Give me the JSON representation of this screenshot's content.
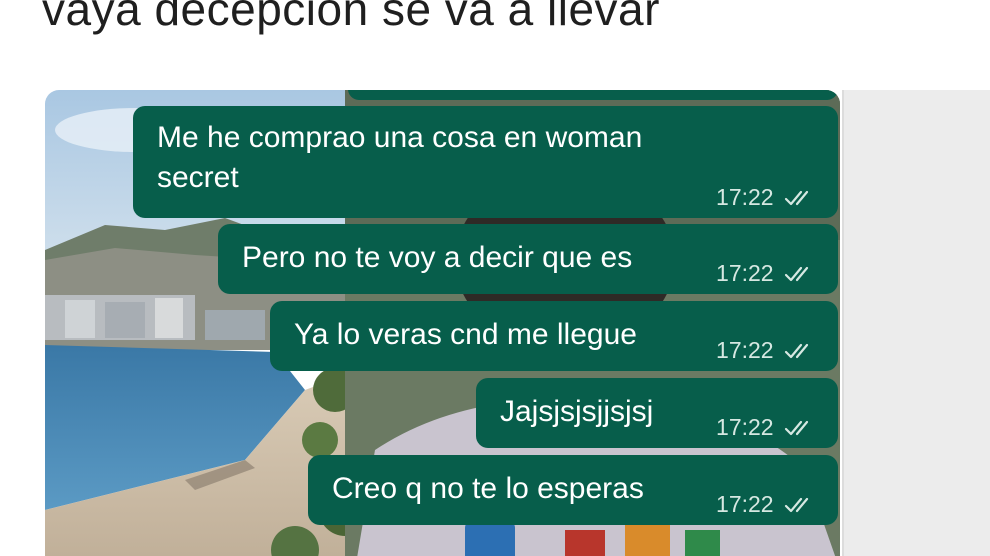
{
  "caption": "vaya decepcion se va a llevar",
  "chat": {
    "messages": [
      {
        "line1": "Me he comprao una cosa en woman",
        "line2": "secret",
        "time": "17:22"
      },
      {
        "text": "Pero no te voy a decir que es",
        "time": "17:22"
      },
      {
        "text": "Ya lo veras cnd me llegue",
        "time": "17:22"
      },
      {
        "text": "Jajsjsjsjjsjsj",
        "time": "17:22"
      },
      {
        "text": "Creo q no te lo esperas",
        "time": "17:22"
      }
    ]
  },
  "colors": {
    "bubble": "#075e4b",
    "sea": "#3f84b3",
    "sky": "#b9d3e8"
  },
  "icons": {
    "read_receipt": "double-check-icon"
  }
}
